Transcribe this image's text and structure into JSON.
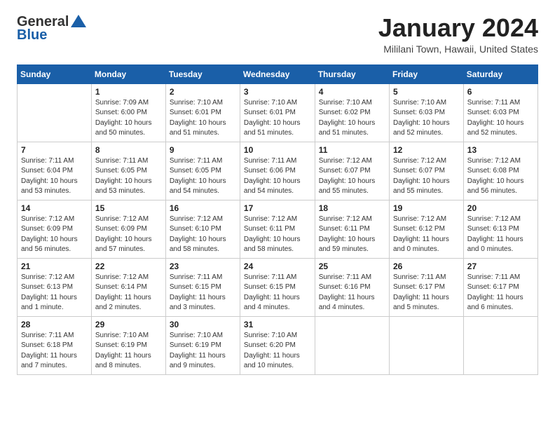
{
  "header": {
    "logo_line1": "General",
    "logo_line2": "Blue",
    "month": "January 2024",
    "location": "Mililani Town, Hawaii, United States"
  },
  "weekdays": [
    "Sunday",
    "Monday",
    "Tuesday",
    "Wednesday",
    "Thursday",
    "Friday",
    "Saturday"
  ],
  "weeks": [
    [
      {
        "day": "",
        "sunrise": "",
        "sunset": "",
        "daylight": ""
      },
      {
        "day": "1",
        "sunrise": "7:09 AM",
        "sunset": "6:00 PM",
        "daylight": "10 hours and 50 minutes."
      },
      {
        "day": "2",
        "sunrise": "7:10 AM",
        "sunset": "6:01 PM",
        "daylight": "10 hours and 51 minutes."
      },
      {
        "day": "3",
        "sunrise": "7:10 AM",
        "sunset": "6:01 PM",
        "daylight": "10 hours and 51 minutes."
      },
      {
        "day": "4",
        "sunrise": "7:10 AM",
        "sunset": "6:02 PM",
        "daylight": "10 hours and 51 minutes."
      },
      {
        "day": "5",
        "sunrise": "7:10 AM",
        "sunset": "6:03 PM",
        "daylight": "10 hours and 52 minutes."
      },
      {
        "day": "6",
        "sunrise": "7:11 AM",
        "sunset": "6:03 PM",
        "daylight": "10 hours and 52 minutes."
      }
    ],
    [
      {
        "day": "7",
        "sunrise": "7:11 AM",
        "sunset": "6:04 PM",
        "daylight": "10 hours and 53 minutes."
      },
      {
        "day": "8",
        "sunrise": "7:11 AM",
        "sunset": "6:05 PM",
        "daylight": "10 hours and 53 minutes."
      },
      {
        "day": "9",
        "sunrise": "7:11 AM",
        "sunset": "6:05 PM",
        "daylight": "10 hours and 54 minutes."
      },
      {
        "day": "10",
        "sunrise": "7:11 AM",
        "sunset": "6:06 PM",
        "daylight": "10 hours and 54 minutes."
      },
      {
        "day": "11",
        "sunrise": "7:12 AM",
        "sunset": "6:07 PM",
        "daylight": "10 hours and 55 minutes."
      },
      {
        "day": "12",
        "sunrise": "7:12 AM",
        "sunset": "6:07 PM",
        "daylight": "10 hours and 55 minutes."
      },
      {
        "day": "13",
        "sunrise": "7:12 AM",
        "sunset": "6:08 PM",
        "daylight": "10 hours and 56 minutes."
      }
    ],
    [
      {
        "day": "14",
        "sunrise": "7:12 AM",
        "sunset": "6:09 PM",
        "daylight": "10 hours and 56 minutes."
      },
      {
        "day": "15",
        "sunrise": "7:12 AM",
        "sunset": "6:09 PM",
        "daylight": "10 hours and 57 minutes."
      },
      {
        "day": "16",
        "sunrise": "7:12 AM",
        "sunset": "6:10 PM",
        "daylight": "10 hours and 58 minutes."
      },
      {
        "day": "17",
        "sunrise": "7:12 AM",
        "sunset": "6:11 PM",
        "daylight": "10 hours and 58 minutes."
      },
      {
        "day": "18",
        "sunrise": "7:12 AM",
        "sunset": "6:11 PM",
        "daylight": "10 hours and 59 minutes."
      },
      {
        "day": "19",
        "sunrise": "7:12 AM",
        "sunset": "6:12 PM",
        "daylight": "11 hours and 0 minutes."
      },
      {
        "day": "20",
        "sunrise": "7:12 AM",
        "sunset": "6:13 PM",
        "daylight": "11 hours and 0 minutes."
      }
    ],
    [
      {
        "day": "21",
        "sunrise": "7:12 AM",
        "sunset": "6:13 PM",
        "daylight": "11 hours and 1 minute."
      },
      {
        "day": "22",
        "sunrise": "7:12 AM",
        "sunset": "6:14 PM",
        "daylight": "11 hours and 2 minutes."
      },
      {
        "day": "23",
        "sunrise": "7:11 AM",
        "sunset": "6:15 PM",
        "daylight": "11 hours and 3 minutes."
      },
      {
        "day": "24",
        "sunrise": "7:11 AM",
        "sunset": "6:15 PM",
        "daylight": "11 hours and 4 minutes."
      },
      {
        "day": "25",
        "sunrise": "7:11 AM",
        "sunset": "6:16 PM",
        "daylight": "11 hours and 4 minutes."
      },
      {
        "day": "26",
        "sunrise": "7:11 AM",
        "sunset": "6:17 PM",
        "daylight": "11 hours and 5 minutes."
      },
      {
        "day": "27",
        "sunrise": "7:11 AM",
        "sunset": "6:17 PM",
        "daylight": "11 hours and 6 minutes."
      }
    ],
    [
      {
        "day": "28",
        "sunrise": "7:11 AM",
        "sunset": "6:18 PM",
        "daylight": "11 hours and 7 minutes."
      },
      {
        "day": "29",
        "sunrise": "7:10 AM",
        "sunset": "6:19 PM",
        "daylight": "11 hours and 8 minutes."
      },
      {
        "day": "30",
        "sunrise": "7:10 AM",
        "sunset": "6:19 PM",
        "daylight": "11 hours and 9 minutes."
      },
      {
        "day": "31",
        "sunrise": "7:10 AM",
        "sunset": "6:20 PM",
        "daylight": "11 hours and 10 minutes."
      },
      {
        "day": "",
        "sunrise": "",
        "sunset": "",
        "daylight": ""
      },
      {
        "day": "",
        "sunrise": "",
        "sunset": "",
        "daylight": ""
      },
      {
        "day": "",
        "sunrise": "",
        "sunset": "",
        "daylight": ""
      }
    ]
  ],
  "labels": {
    "sunrise_prefix": "Sunrise: ",
    "sunset_prefix": "Sunset: ",
    "daylight_prefix": "Daylight: "
  }
}
